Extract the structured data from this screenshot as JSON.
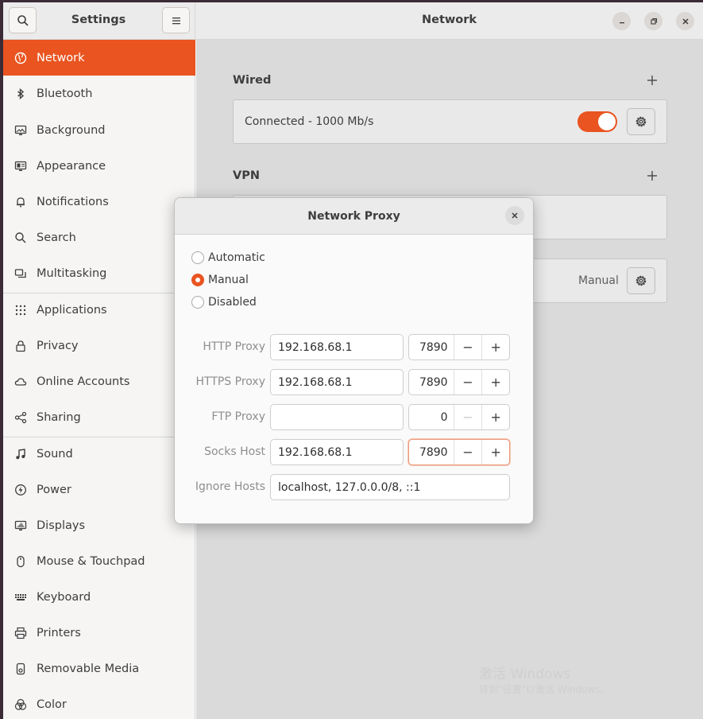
{
  "header": {
    "app_title": "Settings",
    "page_title": "Network",
    "search_icon": "search-icon",
    "menu_icon": "hamburger-menu-icon",
    "controls": [
      "minimize-icon",
      "restore-icon",
      "close-icon"
    ]
  },
  "sidebar": {
    "items": [
      {
        "label": "Network",
        "icon": "network-icon",
        "active": true
      },
      {
        "label": "Bluetooth",
        "icon": "bluetooth-icon"
      },
      {
        "label": "Background",
        "icon": "background-icon"
      },
      {
        "label": "Appearance",
        "icon": "appearance-icon"
      },
      {
        "label": "Notifications",
        "icon": "bell-icon"
      },
      {
        "label": "Search",
        "icon": "search-icon"
      },
      {
        "label": "Multitasking",
        "icon": "multitasking-icon"
      },
      {
        "label": "Applications",
        "icon": "grid-icon"
      },
      {
        "label": "Privacy",
        "icon": "lock-icon"
      },
      {
        "label": "Online Accounts",
        "icon": "cloud-icon"
      },
      {
        "label": "Sharing",
        "icon": "share-icon"
      },
      {
        "label": "Sound",
        "icon": "music-note-icon"
      },
      {
        "label": "Power",
        "icon": "power-icon"
      },
      {
        "label": "Displays",
        "icon": "display-icon"
      },
      {
        "label": "Mouse & Touchpad",
        "icon": "mouse-icon"
      },
      {
        "label": "Keyboard",
        "icon": "keyboard-icon"
      },
      {
        "label": "Printers",
        "icon": "printer-icon"
      },
      {
        "label": "Removable Media",
        "icon": "removable-media-icon"
      },
      {
        "label": "Color",
        "icon": "color-icon"
      }
    ]
  },
  "main": {
    "wired": {
      "title": "Wired",
      "status": "Connected - 1000 Mb/s",
      "toggle_on": true
    },
    "vpn": {
      "title": "VPN"
    },
    "proxy": {
      "value": "Manual"
    }
  },
  "dialog": {
    "title": "Network Proxy",
    "methods": [
      {
        "label": "Automatic",
        "selected": false
      },
      {
        "label": "Manual",
        "selected": true
      },
      {
        "label": "Disabled",
        "selected": false
      }
    ],
    "rows": [
      {
        "label": "HTTP Proxy",
        "host": "192.168.68.1",
        "port": "7890"
      },
      {
        "label": "HTTPS Proxy",
        "host": "192.168.68.1",
        "port": "7890"
      },
      {
        "label": "FTP Proxy",
        "host": "",
        "port": "0"
      },
      {
        "label": "Socks Host",
        "host": "192.168.68.1",
        "port": "7890"
      }
    ],
    "ignore_label": "Ignore Hosts",
    "ignore_value": "localhost, 127.0.0.0/8, ::1",
    "minus": "−",
    "plus": "+"
  },
  "watermark": {
    "line1": "激活 Windows",
    "line2": "转到\"设置\"以激活 Windows。"
  },
  "colors": {
    "accent": "#e95420"
  }
}
